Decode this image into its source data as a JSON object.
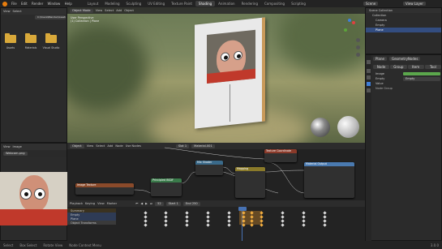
{
  "topbar": {
    "menus": [
      "File",
      "Edit",
      "Render",
      "Window",
      "Help"
    ],
    "tabs": [
      "Layout",
      "Modeling",
      "Sculpting",
      "UV Editing",
      "Texture Paint",
      "Shading",
      "Animation",
      "Rendering",
      "Compositing",
      "Scripting"
    ],
    "active_tab": "Shading",
    "scene": "Scene",
    "view_layer": "View Layer"
  },
  "filebrowser": {
    "header": [
      "View",
      "Select"
    ],
    "path": "C:\\Users\\Blender\\Assets\\",
    "folders": [
      "Assets",
      "Materials",
      "Visual Studio"
    ]
  },
  "viewport": {
    "mode": "Object Mode",
    "menus": [
      "View",
      "Select",
      "Add",
      "Object"
    ],
    "info_line1": "User Perspective",
    "info_line2": "(1) Collection | Plane"
  },
  "outliner": {
    "title": "Scene Collection",
    "items": [
      "Collection",
      "Camera",
      "Empty",
      "Plane"
    ]
  },
  "properties": {
    "object": "Plane",
    "modifier": "GeometryNodes",
    "tabs": [
      "Node",
      "Group",
      "Item",
      "Tool"
    ],
    "fields": [
      {
        "label": "Image",
        "value": ""
      },
      {
        "label": "Empty",
        "value": "Empty"
      },
      {
        "label": "Value",
        "value": ""
      }
    ],
    "section": "Node Group"
  },
  "nodeeditor": {
    "header": [
      "Object",
      "View",
      "Select",
      "Add",
      "Node",
      "Use Nodes"
    ],
    "slot": "Slot 1",
    "material": "Material.001",
    "nodes": [
      {
        "title": "Image Texture",
        "color": "#8a4a2a"
      },
      {
        "title": "Principled BSDF",
        "color": "#3a7a4a"
      },
      {
        "title": "Mix Shader",
        "color": "#3a6a8a"
      },
      {
        "title": "Mapping",
        "color": "#8a7a2a"
      },
      {
        "title": "Material Output",
        "color": "#4a7ab0"
      },
      {
        "title": "Texture Coordinate",
        "color": "#8a3a2a"
      }
    ]
  },
  "imgeditor": {
    "header": [
      "View",
      "Image"
    ],
    "image_name": "Webcam.png"
  },
  "timeline": {
    "header": [
      "Playback",
      "Keying",
      "View",
      "Marker"
    ],
    "start": "Start 1",
    "end": "End 250",
    "current_frame": "52",
    "tracks": [
      "Summary",
      "Empty",
      "Plane",
      "Object Transforms"
    ]
  },
  "statusbar": {
    "items": [
      "Select",
      "Box Select",
      "Rotate View",
      "Node Context Menu"
    ],
    "version": "3.0.0"
  }
}
